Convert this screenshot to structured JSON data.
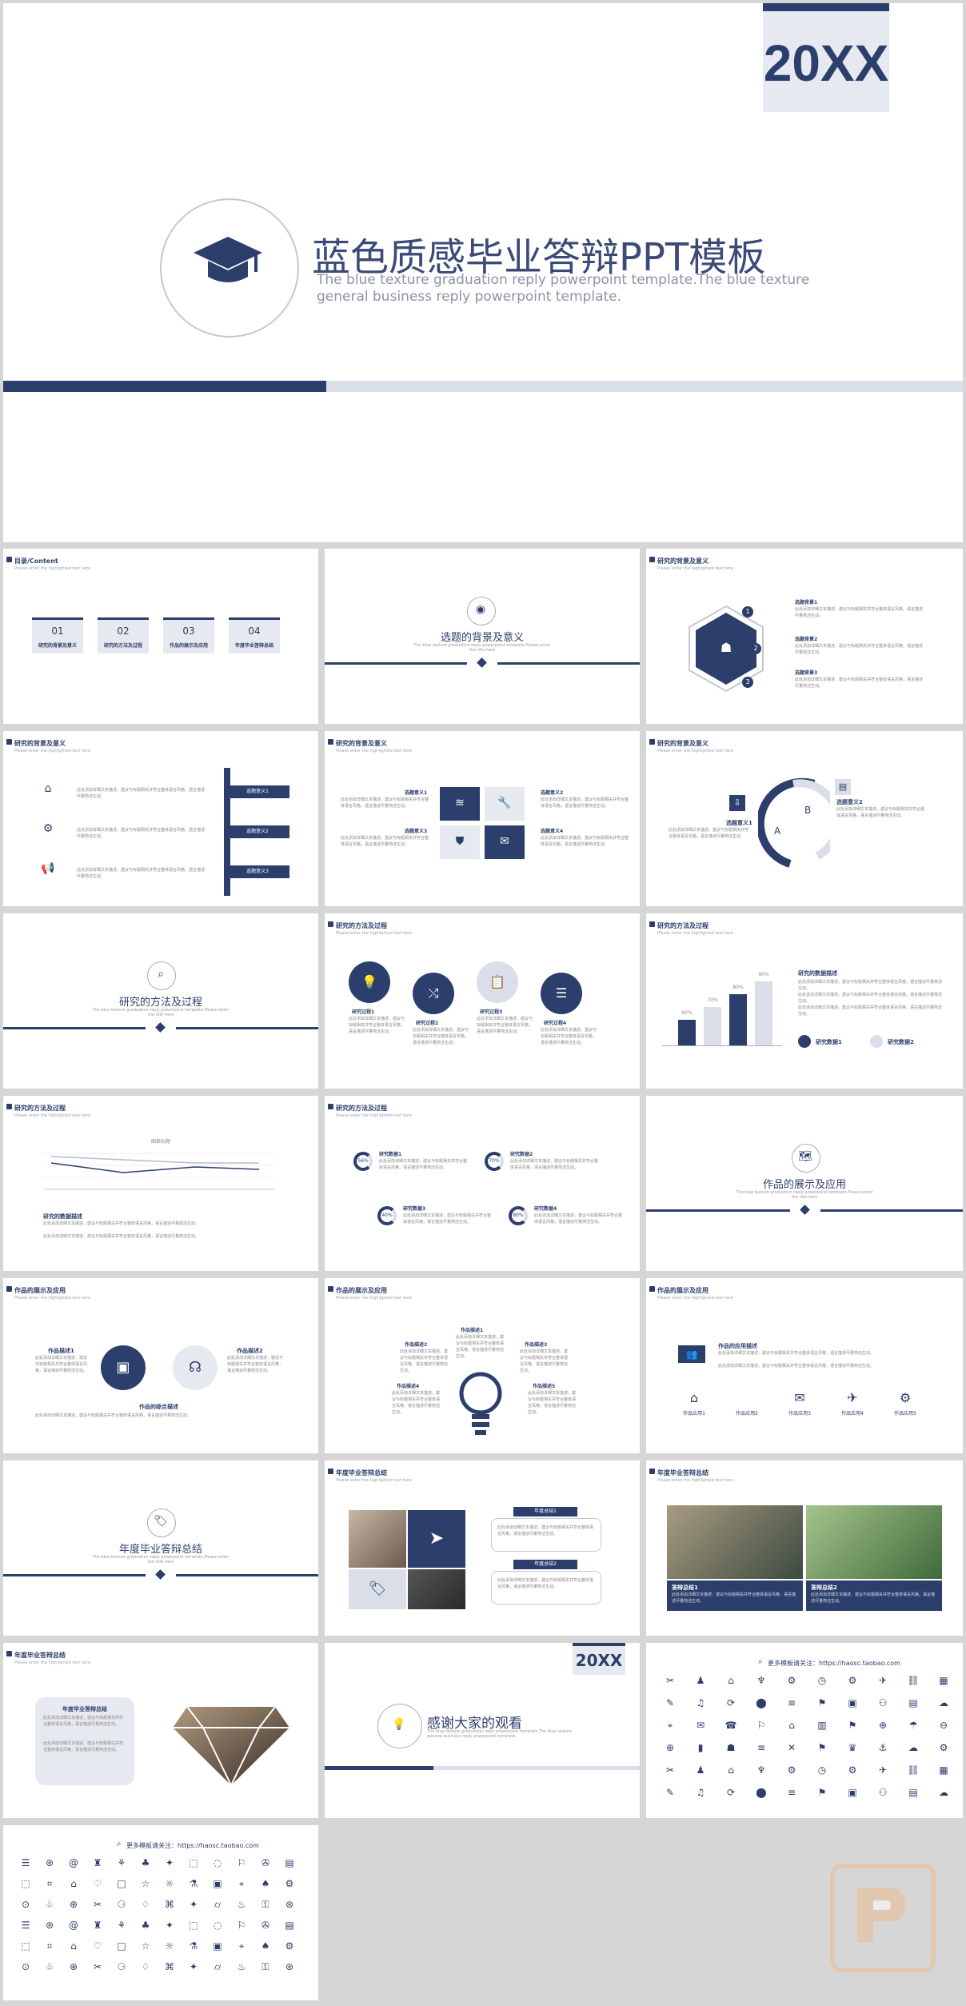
{
  "cover": {
    "year": "20XX",
    "title": "蓝色质感毕业答辩PPT模板",
    "subtitle_line1": "The blue texture graduation  reply powerpoint template.The blue texture",
    "subtitle_line2": "general business reply powerpoint template."
  },
  "common": {
    "section_sub": "Please enter the highlighted text here",
    "lorem": "此处添加详细文本描述，建议与标题相关并符合整体语言风格，语言描述尽量简洁生动。",
    "section_en": "The blue texture graduation reply powerpoint template.Please enter the title here"
  },
  "toc": {
    "title": "目录/Content",
    "items": [
      {
        "num": "01",
        "label": "研究的背景及意义"
      },
      {
        "num": "02",
        "label": "研究的方法及过程"
      },
      {
        "num": "03",
        "label": "作品的展示及应用"
      },
      {
        "num": "04",
        "label": "年度毕业答辩总结"
      }
    ]
  },
  "sections": {
    "s1": "选题的背景及意义",
    "s2": "研究的方法及过程",
    "s3": "作品的展示及应用",
    "s4": "年度毕业答辩总结"
  },
  "slide_titles": {
    "bg": "研究的背景及意义",
    "method": "研究的方法及过程",
    "works": "作品的展示及应用",
    "summary": "年度毕业答辩总结"
  },
  "labels": {
    "bg_items": [
      "选题背景1",
      "选题背景2",
      "选题背景3"
    ],
    "bg_pencil": [
      "选题意义1",
      "选题意义2",
      "选题意义3"
    ],
    "bg_quad": [
      "选题意义1",
      "选题意义2",
      "选题意义3",
      "选题意义4"
    ],
    "bg_ab": [
      "选题意义1",
      "选题意义2"
    ],
    "ab_letters": [
      "A",
      "B"
    ],
    "process": [
      "研究过程1",
      "研究过程2",
      "研究过程3",
      "研究过程4"
    ],
    "bars_head": "研究的数据描述",
    "bars_pct": [
      "60%",
      "70%",
      "80%",
      "90%"
    ],
    "bars_legend": [
      "研究数据1",
      "研究数据2"
    ],
    "chart_title": "图表标题",
    "chart_desc": "研究的数据描述",
    "donut_labels": [
      "研究数据1",
      "研究数据2",
      "研究数据3",
      "研究数据4"
    ],
    "donut_pct": [
      "56%",
      "70%",
      "40%",
      "80%"
    ],
    "works_a": [
      "作品描述1",
      "作品描述2",
      "作品的综合描述"
    ],
    "works_bulb": [
      "作品描述1",
      "作品描述2",
      "作品描述3",
      "作品描述4",
      "作品描述5"
    ],
    "works_icons": [
      "作品应用1",
      "作品应用2",
      "作品应用3",
      "作品应用4",
      "作品应用5"
    ],
    "works_icons_head": "作品的应用描述",
    "summary_box": [
      "年度总结1",
      "年度总结2"
    ],
    "summary_photo": [
      "答辩总结1",
      "答辩总结2"
    ],
    "summary_diamond": "年度毕业答辩总结",
    "thanks": "感谢大家的观看",
    "thanks_year": "20XX",
    "thanks_en": "The blue texture graduation reply powerpoint template.The blue texture general business reply powerpoint template.",
    "more": "更多模板请关注：https://haosc.taobao.com"
  },
  "colors": {
    "navy": "#2c3e6b",
    "light": "#d9dee8",
    "gray": "#b7bcc8"
  }
}
